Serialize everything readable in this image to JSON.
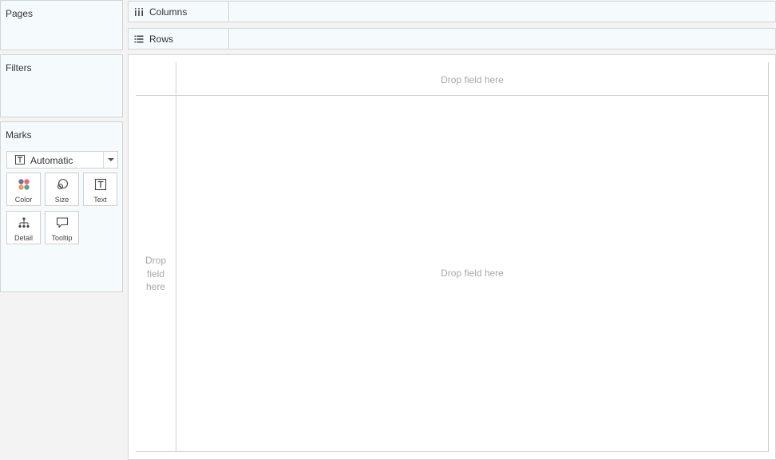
{
  "pages": {
    "title": "Pages"
  },
  "filters": {
    "title": "Filters"
  },
  "marks": {
    "title": "Marks",
    "mark_type": {
      "icon": "text-mark-icon",
      "label": "Automatic"
    },
    "cards": [
      {
        "label": "Color",
        "icon": "color-dots-icon"
      },
      {
        "label": "Size",
        "icon": "size-circles-icon"
      },
      {
        "label": "Text",
        "icon": "text-t-icon"
      },
      {
        "label": "Detail",
        "icon": "detail-tree-icon"
      },
      {
        "label": "Tooltip",
        "icon": "tooltip-bubble-icon"
      }
    ]
  },
  "shelves": {
    "columns": {
      "label": "Columns",
      "icon": "columns-icon"
    },
    "rows": {
      "label": "Rows",
      "icon": "rows-icon"
    }
  },
  "view": {
    "column_header_drop": "Drop field here",
    "row_header_drop": [
      "Drop",
      "field",
      "here"
    ],
    "center_drop": "Drop field here"
  },
  "colors": {
    "card_background": "#f5fbfd",
    "border": "#d4d4d4",
    "placeholder_text": "#a8a8a8",
    "color_dots": [
      "#7b6e8f",
      "#e76a78",
      "#f09a5a",
      "#5f9f8f"
    ]
  }
}
